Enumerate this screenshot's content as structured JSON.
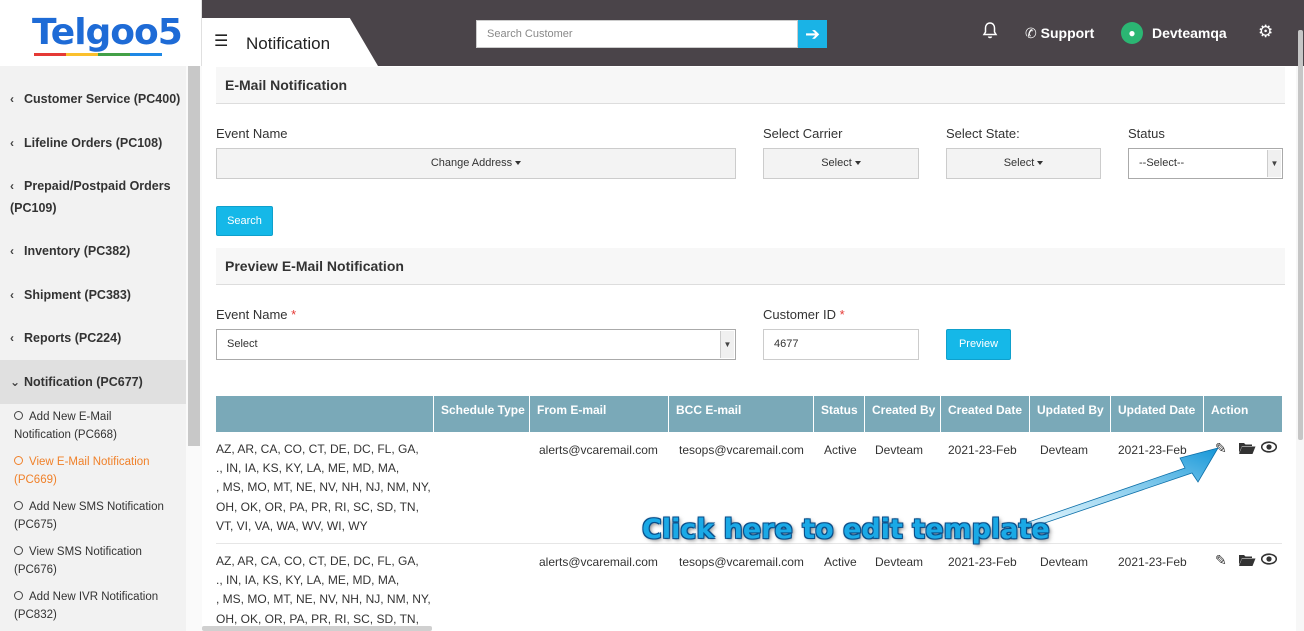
{
  "app": {
    "logo_text": "Telgoo5",
    "page_title": "Notification"
  },
  "topbar": {
    "search_placeholder": "Search Customer",
    "support_label": "Support",
    "username": "Devteamqa"
  },
  "sidebar": {
    "items": [
      {
        "label": "Customer Service (PC400)"
      },
      {
        "label": "Lifeline Orders (PC108)"
      },
      {
        "label": "Prepaid/Postpaid Orders"
      },
      {
        "label": "(PC109)"
      },
      {
        "label": "Inventory (PC382)"
      },
      {
        "label": "Shipment (PC383)"
      },
      {
        "label": "Reports (PC224)"
      },
      {
        "label": "Notification (PC677)"
      }
    ],
    "subitems": [
      {
        "l1": "Add New E-Mail",
        "l2": "Notification (PC668)"
      },
      {
        "l1": "View E-Mail Notification",
        "l2": "(PC669)"
      },
      {
        "l1": "Add New SMS Notification",
        "l2": "(PC675)"
      },
      {
        "l1": "View SMS Notification",
        "l2": "(PC676)"
      },
      {
        "l1": "Add New IVR Notification",
        "l2": "(PC832)"
      }
    ]
  },
  "email_section": {
    "title": "E-Mail Notification",
    "event_label": "Event Name",
    "event_value": "Change Address",
    "carrier_label": "Select Carrier",
    "carrier_value": "Select",
    "state_label": "Select State:",
    "state_value": "Select",
    "status_label": "Status",
    "status_value": "--Select--",
    "search_label": "Search"
  },
  "preview_section": {
    "title": "Preview E-Mail Notification",
    "event_label": "Event Name",
    "event_value": "Select",
    "customer_label": "Customer ID",
    "customer_value": "4677",
    "preview_label": "Preview",
    "required_mark": "*"
  },
  "table": {
    "headers": [
      "Schedule Type",
      "From E-mail",
      "BCC E-mail",
      "Status",
      "Created By",
      "Created Date",
      "Updated By",
      "Updated Date",
      "Action"
    ],
    "rows": [
      {
        "states": [
          "AZ, AR, CA, CO, CT, DE, DC, FL, GA,",
          "., IN, IA, KS, KY, LA, ME, MD, MA,",
          ", MS, MO, MT, NE, NV, NH, NJ, NM, NY,",
          " OH, OK, OR, PA, PR, RI, SC, SD, TN,",
          "VT, VI, VA, WA, WV, WI, WY"
        ],
        "from": "alerts@vcaremail.com",
        "bcc": "tesops@vcaremail.com",
        "status": "Active",
        "created_by": "Devteam",
        "created_date": "2021-23-Feb",
        "updated_by": "Devteam",
        "updated_date": "2021-23-Feb"
      },
      {
        "states": [
          "AZ, AR, CA, CO, CT, DE, DC, FL, GA,",
          "., IN, IA, KS, KY, LA, ME, MD, MA,",
          ", MS, MO, MT, NE, NV, NH, NJ, NM, NY,",
          " OH, OK, OR, PA, PR, RI, SC, SD, TN,"
        ],
        "from": "alerts@vcaremail.com",
        "bcc": "tesops@vcaremail.com",
        "status": "Active",
        "created_by": "Devteam",
        "created_date": "2021-23-Feb",
        "updated_by": "Devteam",
        "updated_date": "2021-23-Feb"
      }
    ]
  },
  "annotation": {
    "text": "Click here to edit template"
  },
  "icons": {
    "hamburger": "menu-icon",
    "search_go": "arrow-right-icon",
    "bell": "bell-icon",
    "support": "phone-icon",
    "user": "user-avatar-icon",
    "settings": "gear-icon",
    "edit": "pencil-icon",
    "folder": "folder-open-icon",
    "view": "eye-icon"
  },
  "colors": {
    "topbar": "#4a4449",
    "accent": "#15b8e8",
    "table_header": "#7aa9b8",
    "active_link": "#f0812a",
    "logo": "#1e6bd6"
  }
}
